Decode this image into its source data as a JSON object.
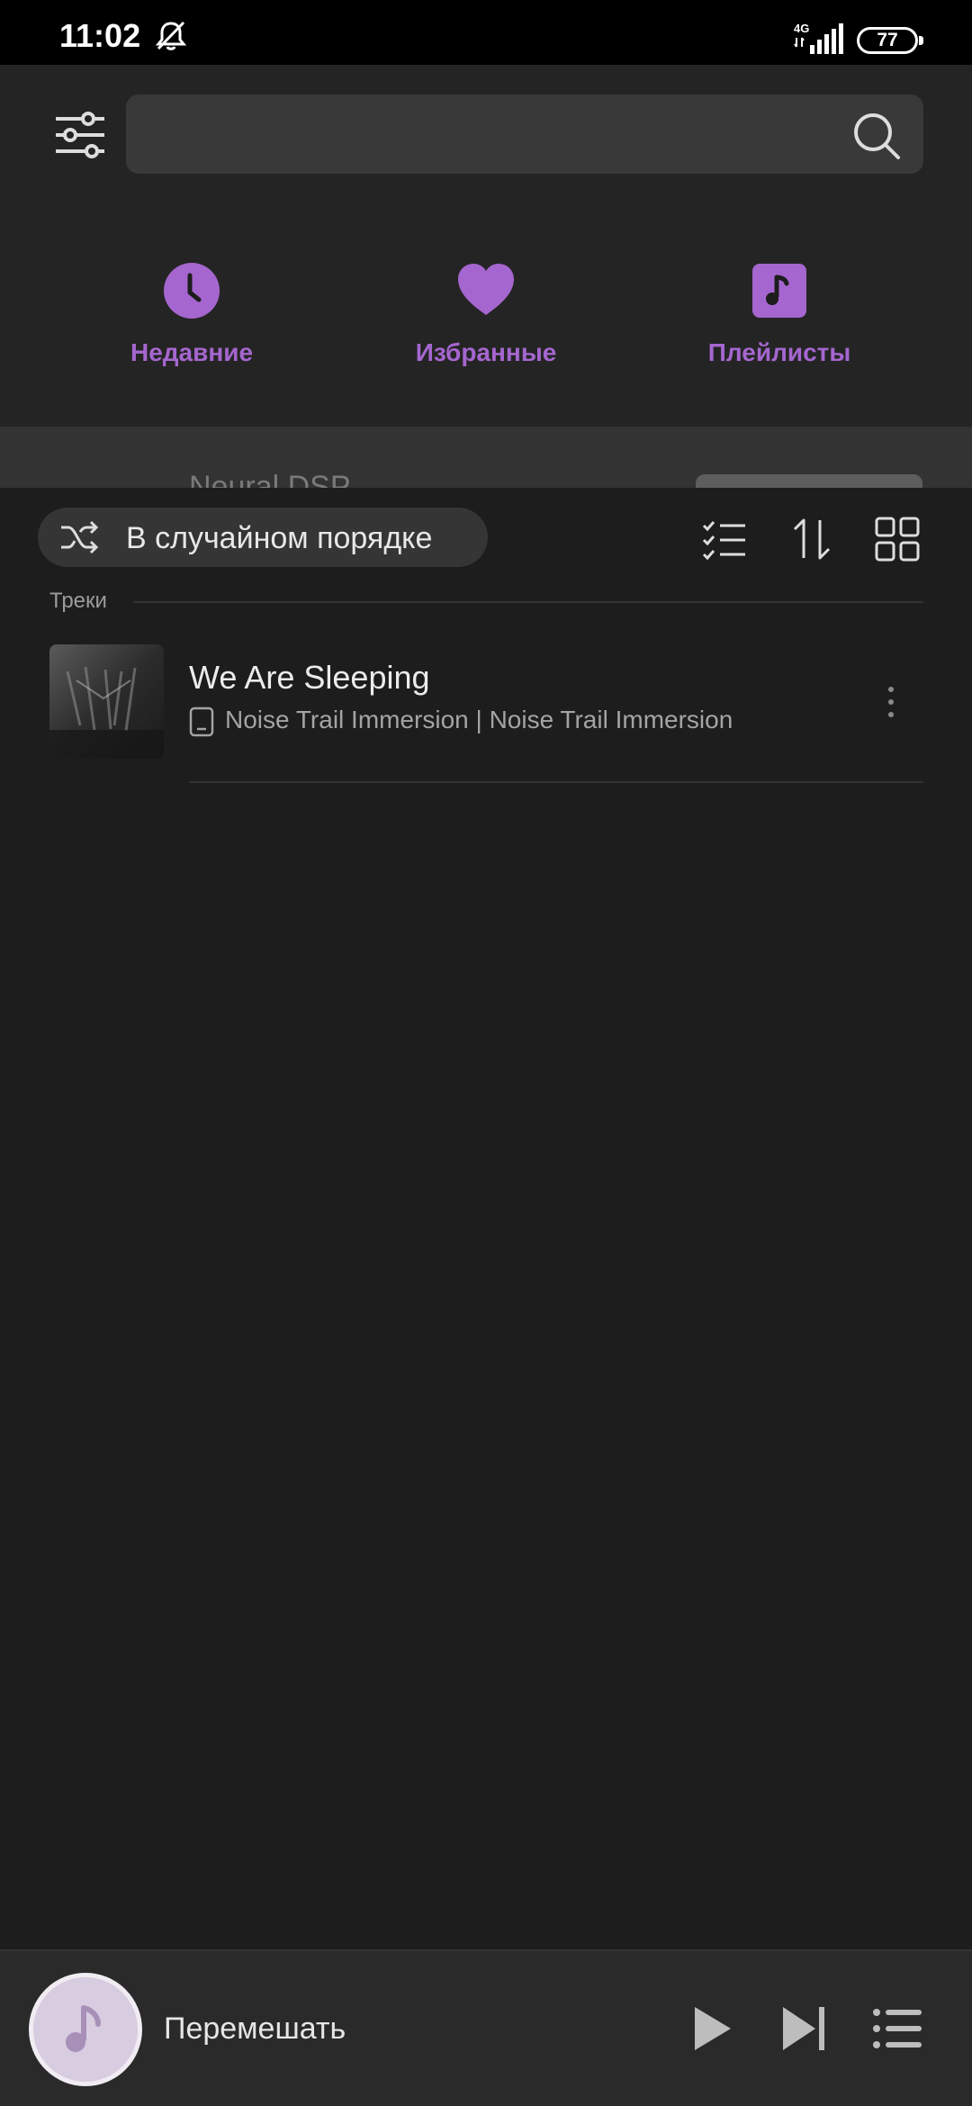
{
  "status": {
    "time": "11:02",
    "network": "4G",
    "battery": "77"
  },
  "search": {
    "placeholder": "",
    "value": ""
  },
  "quick_actions": [
    {
      "label": "Недавние",
      "icon": "clock-icon"
    },
    {
      "label": "Избранные",
      "icon": "heart-icon"
    },
    {
      "label": "Плейлисты",
      "icon": "playlist-icon"
    }
  ],
  "peek": {
    "text": "Neural DSP"
  },
  "toolbar": {
    "shuffle_label": "В случайном порядке"
  },
  "section": {
    "label": "Треки"
  },
  "tracks": [
    {
      "title": "We Are Sleeping",
      "subtitle": "Noise Trail Immersion | Noise Trail Immersion"
    }
  ],
  "player": {
    "label": "Перемешать"
  },
  "colors": {
    "accent": "#a566cf",
    "background": "#1d1d1d",
    "header": "#242424",
    "search_bg": "#393939"
  }
}
